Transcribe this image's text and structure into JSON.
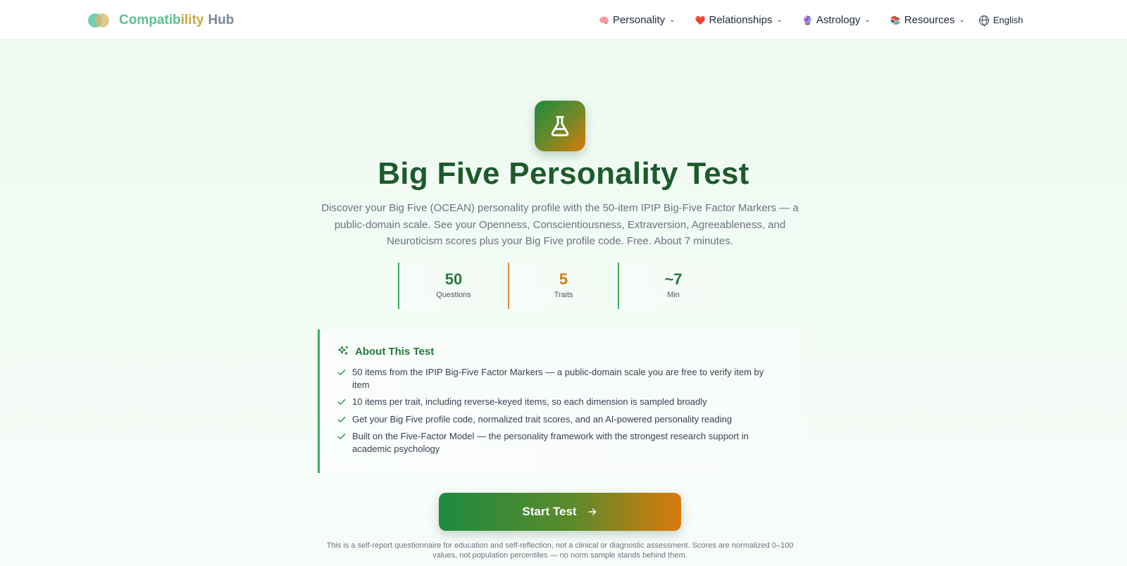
{
  "brand": {
    "name_part1": "Compatib",
    "name_part2": "ility",
    "name_part3": "Hub"
  },
  "nav": {
    "items": [
      {
        "label": "Personality",
        "emoji": "🧠",
        "icon": "brain-icon"
      },
      {
        "label": "Relationships",
        "emoji": "❤️",
        "icon": "heart-icon"
      },
      {
        "label": "Astrology",
        "emoji": "🔮",
        "icon": "crystal-ball-icon"
      },
      {
        "label": "Resources",
        "emoji": "📚",
        "icon": "books-icon"
      }
    ],
    "language": "English"
  },
  "hero": {
    "icon": "flask-icon",
    "title": "Big Five Personality Test",
    "subtitle": "Discover your Big Five (OCEAN) personality profile with the 50-item IPIP Big-Five Factor Markers — a public-domain scale. See your Openness, Conscientiousness, Extraversion, Agreeableness, and Neuroticism scores plus your Big Five profile code. Free. About 7 minutes."
  },
  "stats": [
    {
      "value": "50",
      "label": "Questions"
    },
    {
      "value": "5",
      "label": "Traits"
    },
    {
      "value": "~7",
      "label": "Min"
    }
  ],
  "about": {
    "title": "About This Test",
    "items": [
      "50 items from the IPIP Big-Five Factor Markers — a public-domain scale you are free to verify item by item",
      "10 items per trait, including reverse-keyed items, so each dimension is sampled broadly",
      "Get your Big Five profile code, normalized trait scores, and an AI-powered personality reading",
      "Built on the Five-Factor Model — the personality framework with the strongest research support in academic psychology"
    ]
  },
  "cta": {
    "label": "Start Test"
  },
  "disclaimer": "This is a self-report questionnaire for education and self-reflection, not a clinical or diagnostic assessment. Scores are normalized 0–100 values, not population percentiles — no norm sample stands behind them.",
  "colors": {
    "primary_green": "#237a3a",
    "accent_orange": "#d97a0b",
    "title_green": "#1d5a2c"
  }
}
